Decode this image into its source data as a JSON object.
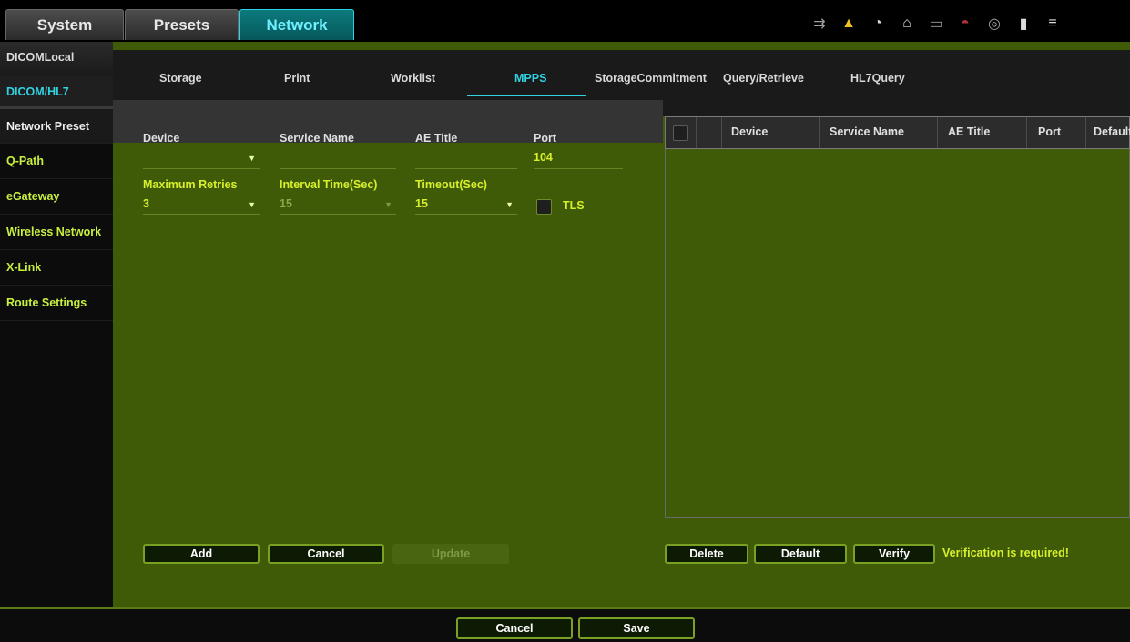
{
  "main_tabs": [
    "System",
    "Presets",
    "Network"
  ],
  "status_icons": [
    "keyboard-icon",
    "warning-icon",
    "network-status-icon",
    "mouse-icon",
    "storage-icon",
    "wireless-icon",
    "cd-icon",
    "battery-icon",
    "menu-icon"
  ],
  "nav": {
    "items": [
      "DICOMLocal",
      "DICOM/HL7",
      "Network Preset",
      "Q-Path",
      "eGateway",
      "Wireless Network",
      "X-Link",
      "Route Settings"
    ]
  },
  "subtabs": [
    "Storage",
    "Print",
    "Worklist",
    "MPPS",
    "StorageCommitment",
    "Query/Retrieve",
    "HL7Query"
  ],
  "form": {
    "device_label": "Device",
    "service_name_label": "Service Name",
    "ae_title_label": "AE Title",
    "port_label": "Port",
    "port_value": "104",
    "max_retries_label": "Maximum Retries",
    "max_retries_value": "3",
    "interval_label": "Interval Time(Sec)",
    "interval_value": "15",
    "timeout_label": "Timeout(Sec)",
    "timeout_value": "15",
    "tls_label": "TLS"
  },
  "form_buttons": {
    "add": "Add",
    "cancel": "Cancel",
    "update": "Update"
  },
  "table": {
    "columns": [
      "Device",
      "Service Name",
      "AE Title",
      "Port",
      "Default"
    ]
  },
  "table_buttons": {
    "delete": "Delete",
    "default": "Default",
    "verify": "Verify"
  },
  "verification_message": "Verification is required!",
  "footer": {
    "cancel": "Cancel",
    "save": "Save"
  },
  "colors": {
    "accent_cyan": "#31d2e2",
    "label_yellow": "#d8f02c",
    "panel_green": "#3f5b08"
  }
}
